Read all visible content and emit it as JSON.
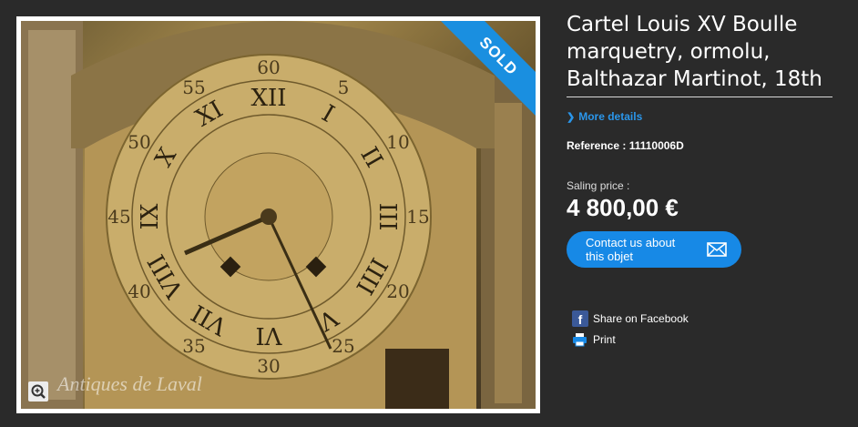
{
  "product": {
    "title": "Cartel Louis XV Boulle marquetry, ormolu, Balthazar Martinot, 18th",
    "more_details": "More details",
    "reference": "Reference : 11110006D",
    "price_label": "Saling price :",
    "price": "4 800,00 €",
    "contact_label": "Contact us about this objet"
  },
  "photo": {
    "badge": "SOLD",
    "watermark": "Antiques de Laval",
    "dial_minutes": [
      "60",
      "5",
      "10",
      "15",
      "20",
      "25",
      "30",
      "35",
      "40",
      "45",
      "50",
      "55"
    ],
    "dial_hours": [
      "XII",
      "I",
      "II",
      "III",
      "IIII",
      "V",
      "VI",
      "VII",
      "VIII",
      "IX",
      "X",
      "XI"
    ]
  },
  "share": {
    "facebook": "Share on Facebook",
    "print": "Print"
  },
  "colors": {
    "background": "#2a2a2a",
    "accent": "#1789e6",
    "link": "#2a96ea"
  },
  "icons": [
    "zoom-icon",
    "chevron-right-icon",
    "mail-icon",
    "facebook-icon",
    "print-icon"
  ]
}
